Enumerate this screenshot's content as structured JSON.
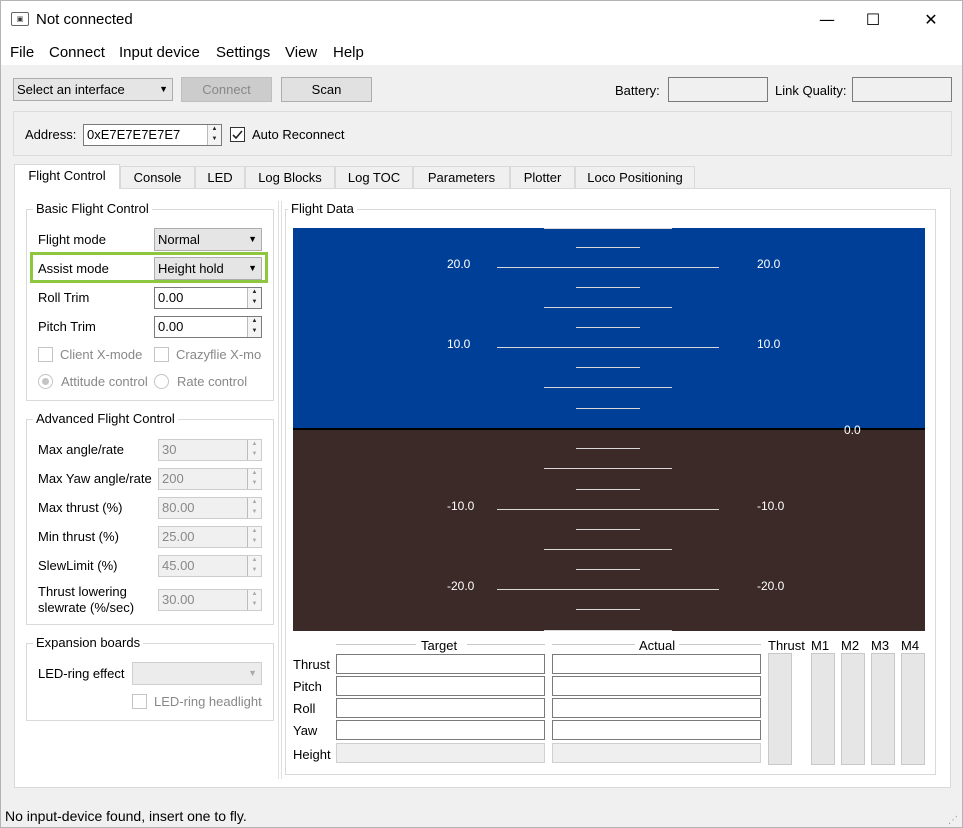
{
  "window": {
    "title": "Not connected",
    "icon": "bitcraze-app-icon",
    "minimize": "—",
    "maximize": "☐",
    "close": "✕"
  },
  "menu": [
    "File",
    "Connect",
    "Input device",
    "Settings",
    "View",
    "Help"
  ],
  "toolbar": {
    "interface_select": "Select an interface",
    "connect_label": "Connect",
    "scan_label": "Scan",
    "battery_label": "Battery:",
    "battery_value": "",
    "link_quality_label": "Link Quality:",
    "link_quality_value": ""
  },
  "address_bar": {
    "address_label": "Address:",
    "address_value": "0xE7E7E7E7E7",
    "auto_reconnect_label": "Auto Reconnect",
    "auto_reconnect_checked": true
  },
  "tabs": [
    "Flight Control",
    "Console",
    "LED",
    "Log Blocks",
    "Log TOC",
    "Parameters",
    "Plotter",
    "Loco Positioning"
  ],
  "active_tab": "Flight Control",
  "basic_flight_control": {
    "title": "Basic Flight Control",
    "flight_mode_label": "Flight mode",
    "flight_mode_value": "Normal",
    "assist_mode_label": "Assist mode",
    "assist_mode_value": "Height hold",
    "roll_trim_label": "Roll Trim",
    "roll_trim_value": "0.00",
    "pitch_trim_label": "Pitch Trim",
    "pitch_trim_value": "0.00",
    "client_xmode_label": "Client X-mode",
    "crazyflie_xmode_label": "Crazyflie X-mo",
    "attitude_control_label": "Attitude control",
    "rate_control_label": "Rate control",
    "highlight_color": "#8dc63f"
  },
  "advanced_flight_control": {
    "title": "Advanced Flight Control",
    "rows": [
      {
        "label": "Max angle/rate",
        "value": "30"
      },
      {
        "label": "Max Yaw angle/rate",
        "value": "200"
      },
      {
        "label": "Max thrust (%)",
        "value": "80.00"
      },
      {
        "label": "Min thrust (%)",
        "value": "25.00"
      },
      {
        "label": "SlewLimit (%)",
        "value": "45.00"
      },
      {
        "label": "Thrust lowering slewrate (%/sec)",
        "value": "30.00"
      }
    ]
  },
  "expansion_boards": {
    "title": "Expansion boards",
    "led_ring_effect_label": "LED-ring effect",
    "led_ring_effect_value": "",
    "led_ring_headlight_label": "LED-ring headlight"
  },
  "flight_data": {
    "title": "Flight Data",
    "sky_color": "#003f97",
    "ground_color": "#3b2a27",
    "pitch_labels": [
      "20.0",
      "10.0",
      "-10.0",
      "-20.0"
    ],
    "roll_value": "0.0",
    "table": {
      "target_header": "Target",
      "actual_header": "Actual",
      "rows": [
        "Thrust",
        "Pitch",
        "Roll",
        "Yaw",
        "Height"
      ]
    },
    "bars": [
      "Thrust",
      "M1",
      "M2",
      "M3",
      "M4"
    ]
  },
  "status": {
    "message": "No input-device found, insert one to fly."
  }
}
